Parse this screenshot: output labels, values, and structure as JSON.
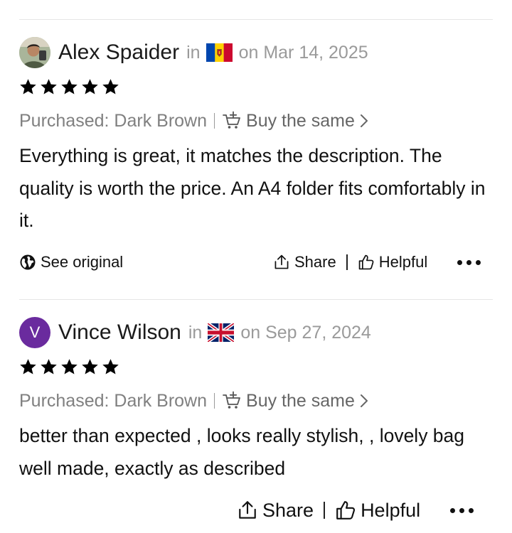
{
  "reviews": [
    {
      "reviewer": "Alex Spaider",
      "in_label": "in",
      "country_flag": "moldova-flag-icon",
      "date": "on Mar 14, 2025",
      "rating": 5,
      "purchased": "Purchased: Dark Brown",
      "buy_same": "Buy the same",
      "text": "Everything is great, it matches the description. The quality is worth the price. An A4 folder fits comfortably in it.",
      "see_original": "See original",
      "share": "Share",
      "helpful": "Helpful"
    },
    {
      "reviewer": "Vince Wilson",
      "avatar_letter": "V",
      "in_label": "in",
      "country_flag": "uk-flag-icon",
      "date": "on Sep 27, 2024",
      "rating": 5,
      "purchased": "Purchased: Dark Brown",
      "buy_same": "Buy the same",
      "text": "better than expected , looks really stylish, , lovely bag well made, exactly as described",
      "share": "Share",
      "helpful": "Helpful"
    }
  ],
  "colors": {
    "avatar_purple": "#6a2b9e",
    "muted_text": "#9a9a9a",
    "star": "#000000"
  }
}
